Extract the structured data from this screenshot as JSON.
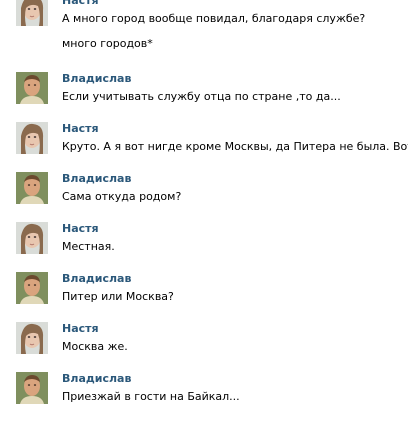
{
  "messages": [
    {
      "author": "Настя",
      "avatar": "female-avatar-photo",
      "lines": [
        "А много город вообще повидал, благодаря службе?",
        "много городов*"
      ]
    },
    {
      "author": "Владислав",
      "avatar": "male-avatar-photo",
      "lines": [
        "Если учитывать службу отца по стране ,то да..."
      ]
    },
    {
      "author": "Настя",
      "avatar": "female-avatar-photo",
      "lines": [
        "Круто. А я вот нигде кроме Москвы, да Питера не была. Вот."
      ]
    },
    {
      "author": "Владислав",
      "avatar": "male-avatar-photo",
      "lines": [
        "Сама откуда родом?"
      ]
    },
    {
      "author": "Настя",
      "avatar": "female-avatar-photo",
      "lines": [
        "Местная."
      ]
    },
    {
      "author": "Владислав",
      "avatar": "male-avatar-photo",
      "lines": [
        "Питер или Москва?"
      ]
    },
    {
      "author": "Настя",
      "avatar": "female-avatar-photo",
      "lines": [
        "Москва же."
      ]
    },
    {
      "author": "Владислав",
      "avatar": "male-avatar-photo",
      "lines": [
        "Приезжай в гости на Байкал..."
      ]
    }
  ]
}
